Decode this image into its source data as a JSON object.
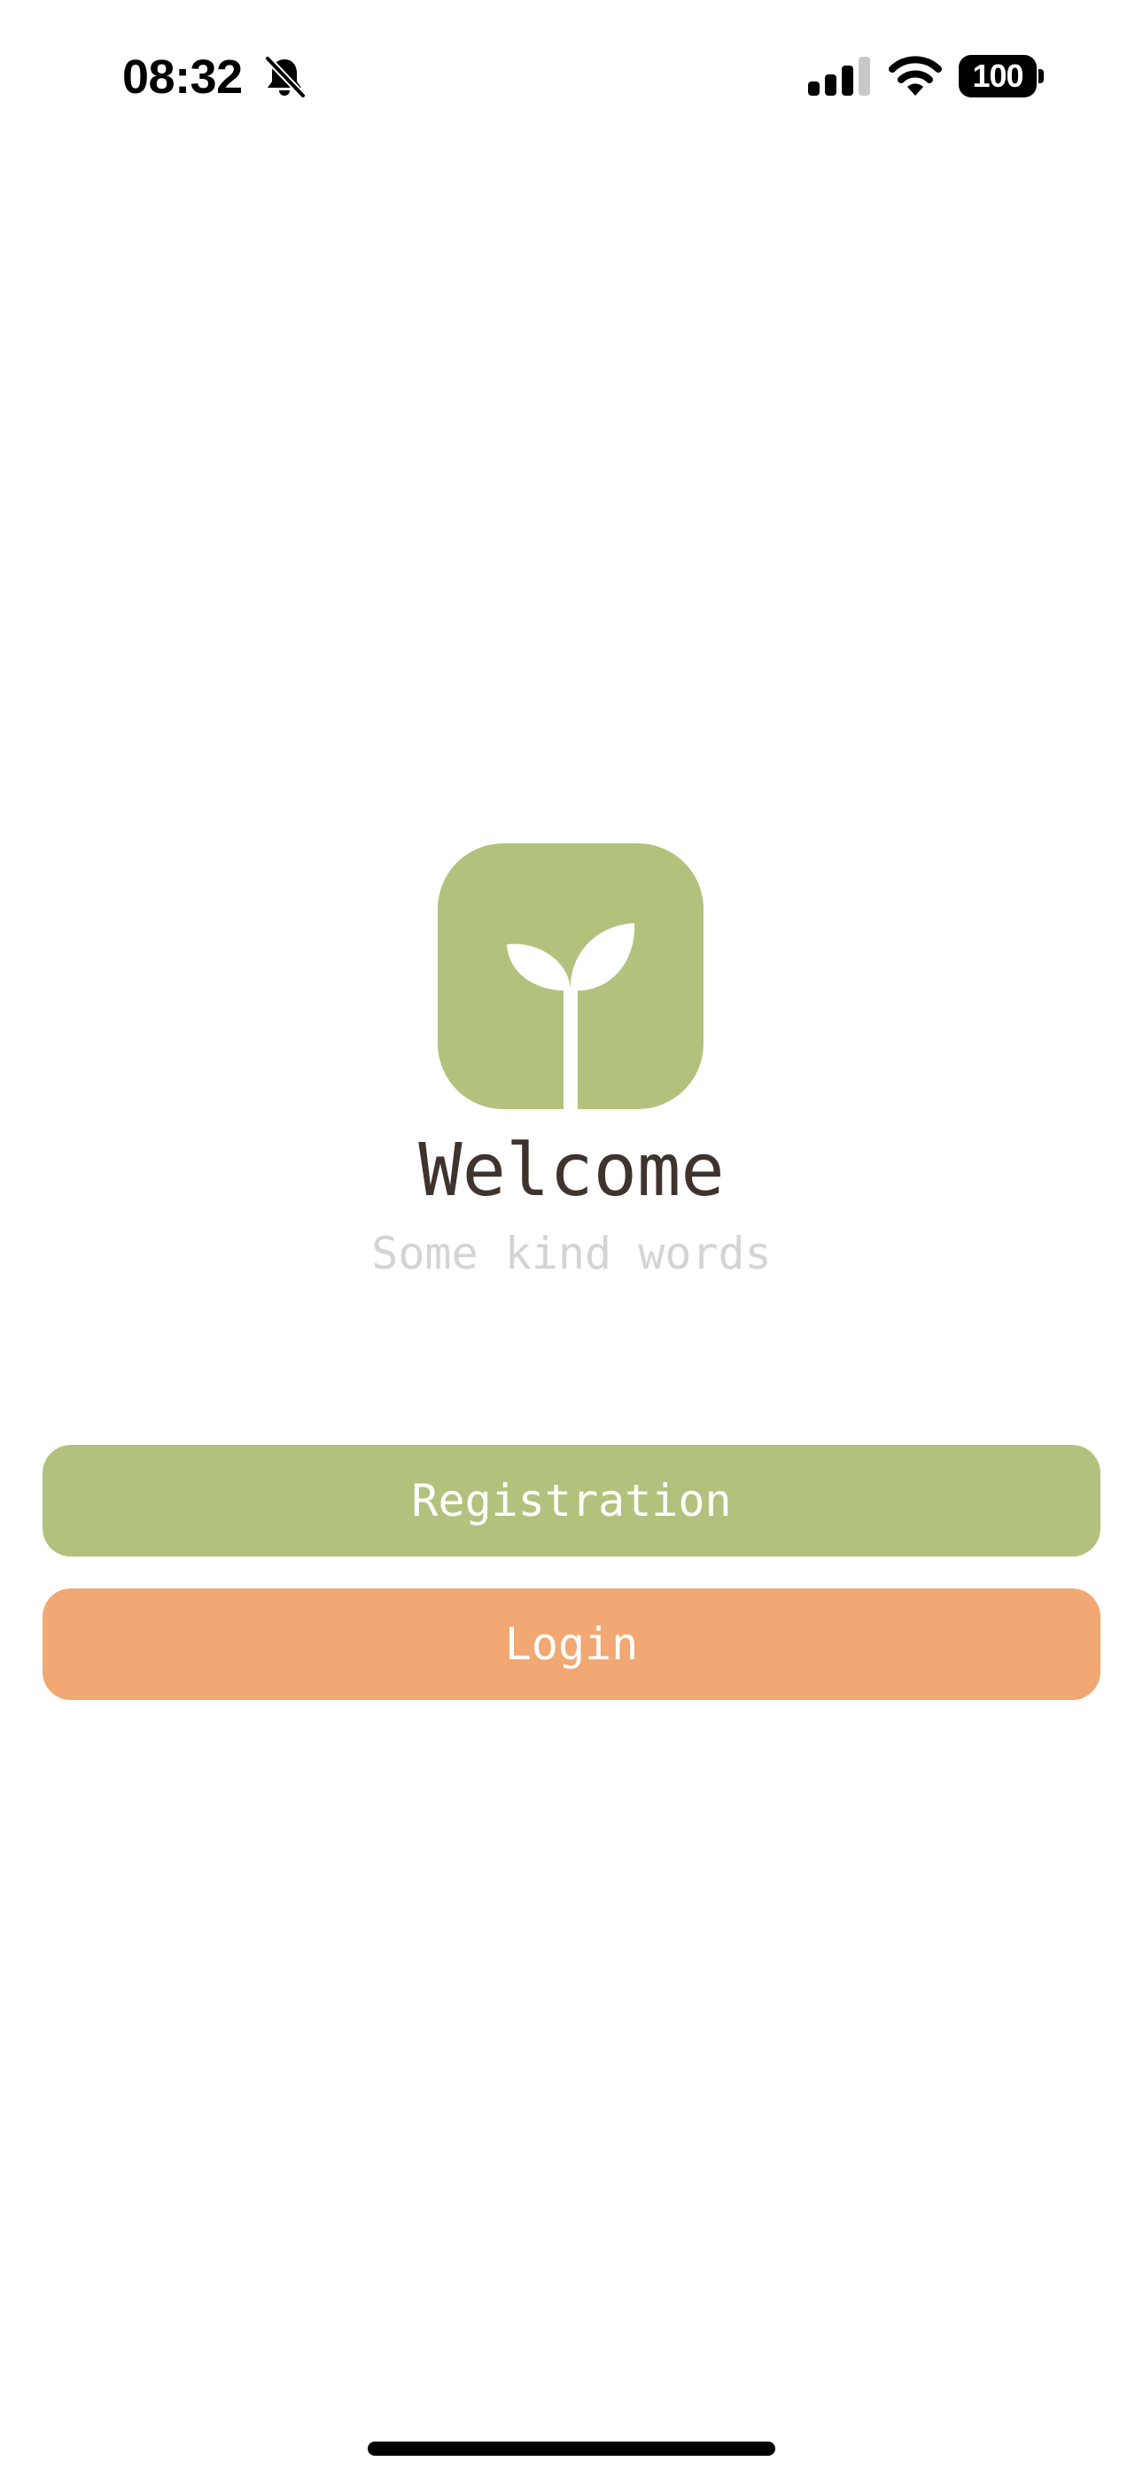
{
  "status_bar": {
    "time": "08:32",
    "silent_icon": "bell-slash-icon",
    "signal_icon": "cellular-signal-icon",
    "wifi_icon": "wifi-icon",
    "battery_level": "100"
  },
  "logo": {
    "icon": "sprout-icon",
    "background_color": "#B2C27D"
  },
  "welcome": {
    "title": "Welcome",
    "subtitle": "Some kind words"
  },
  "buttons": {
    "registration_label": "Registration",
    "login_label": "Login"
  },
  "colors": {
    "primary_green": "#B2C27D",
    "accent_orange": "#F1A873",
    "title_text": "#3F332E",
    "subtitle_text": "#D4D4D4"
  }
}
